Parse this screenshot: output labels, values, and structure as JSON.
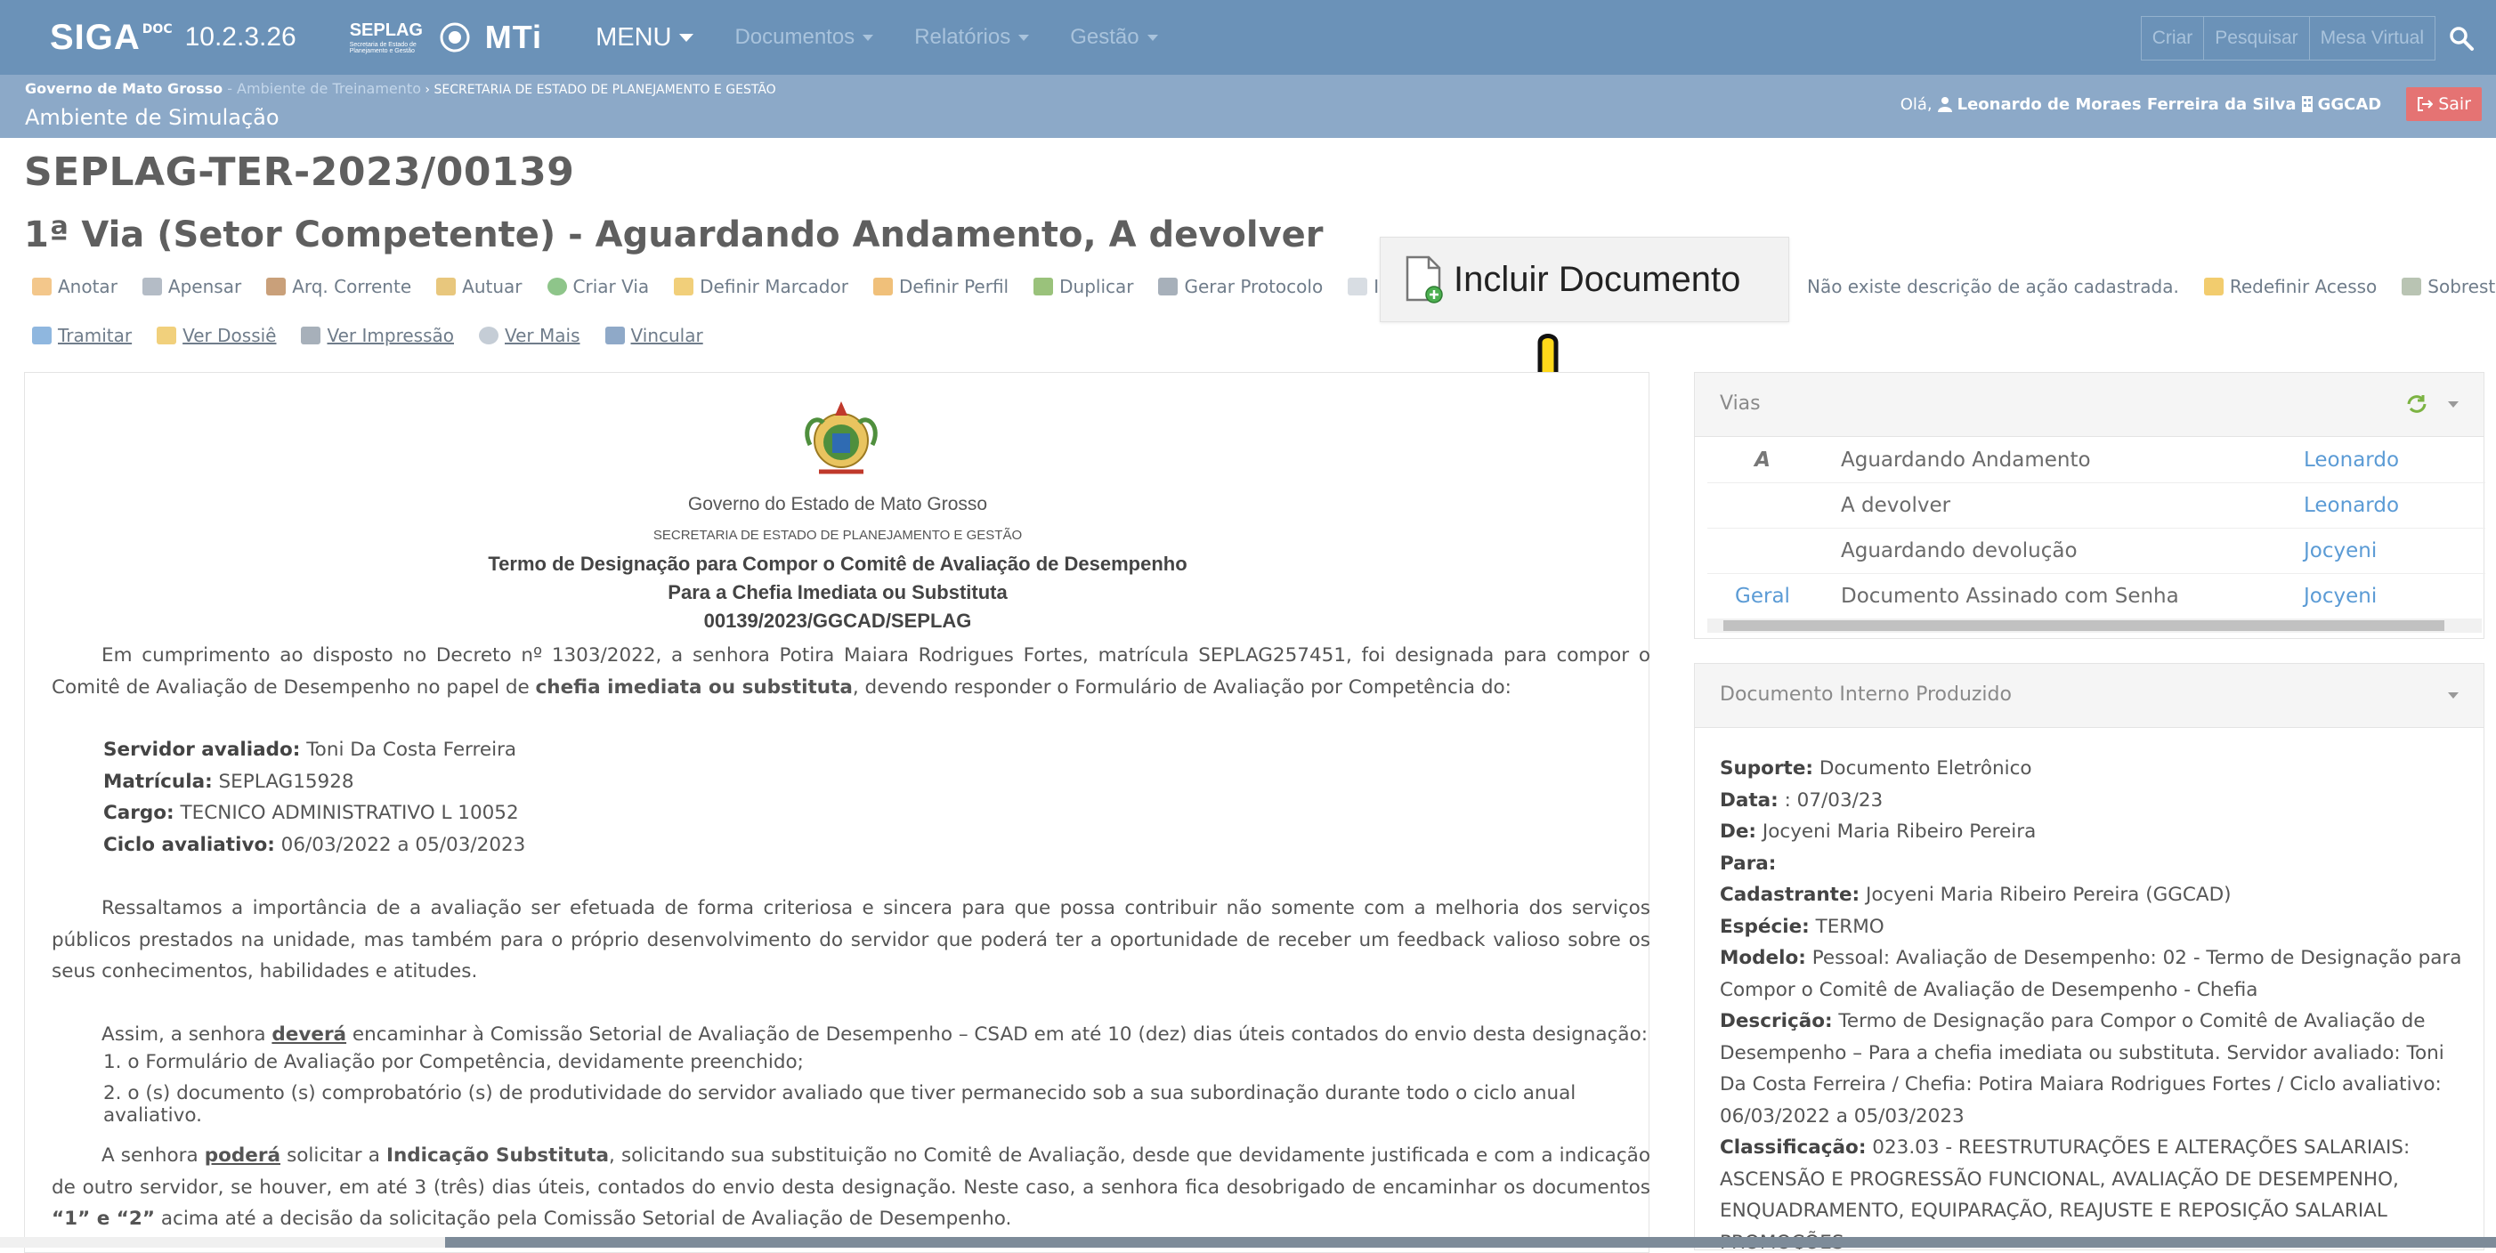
{
  "app": {
    "brand": "SIGA",
    "brand_sup": "DOC",
    "version": "10.2.3.26",
    "seplag": "SEPLAG",
    "seplag_sub": "Secretaria de Estado de Planejamento e Gestão",
    "mti": "MTi"
  },
  "nav": {
    "menu": "MENU",
    "items": [
      "Documentos",
      "Relatórios",
      "Gestão"
    ],
    "right_buttons": [
      "Criar",
      "Pesquisar",
      "Mesa Virtual"
    ]
  },
  "breadcrumb": {
    "gov": "Governo de Mato Grosso",
    "env": " - Ambiente de Treinamento",
    "sec": " › SECRETARIA DE ESTADO DE PLANEJAMENTO E GESTÃO",
    "sim": "Ambiente de Simulação"
  },
  "user": {
    "greeting": "Olá,",
    "name": "Leonardo de Moraes Ferreira da Silva",
    "unit": "GGCAD",
    "logout": "Sair"
  },
  "doc": {
    "code": "SEPLAG-TER-2023/00139",
    "status": "1ª Via (Setor Competente) - Aguardando Andamento, A devolver"
  },
  "toolbar": {
    "row1": [
      "Anotar",
      "Apensar",
      "Arq. Corrente",
      "Autuar",
      "Criar Via",
      "Definir Marcador",
      "Definir Perfil",
      "Duplicar",
      "Gerar Protocolo",
      "Inc",
      "Não existe descrição de ação cadastrada.",
      "Redefinir Acesso",
      "Sobrestar"
    ],
    "row2": [
      "Tramitar",
      "Ver Dossiê",
      "Ver Impressão",
      "Ver Mais",
      "Vincular"
    ]
  },
  "tooltip": {
    "label": "Incluir Documento"
  },
  "document": {
    "gov": "Governo do Estado de Mato Grosso",
    "sec": "SECRETARIA DE ESTADO DE PLANEJAMENTO E GESTÃO",
    "title": "Termo de Designação para Compor o Comitê de Avaliação de Desempenho",
    "subtitle": "Para a Chefia Imediata ou Substituta",
    "number": "00139/2023/GGCAD/SEPLAG",
    "p1_a": "Em cumprimento ao disposto no Decreto nº 1303/2022, a senhora Potira Maiara Rodrigues Fortes, matrícula SEPLAG257451, foi designada para compor o Comitê de Avaliação de Desempenho no papel de ",
    "p1_b": "chefia imediata ou substituta",
    "p1_c": ", devendo responder o Formulário de Avaliação por Competência do:",
    "fields": [
      {
        "label": "Servidor avaliado:",
        "value": "Toni Da Costa Ferreira"
      },
      {
        "label": "Matrícula:",
        "value": "SEPLAG15928"
      },
      {
        "label": "Cargo:",
        "value": "TECNICO ADMINISTRATIVO L 10052"
      },
      {
        "label": "Ciclo avaliativo:",
        "value": "06/03/2022 a 05/03/2023"
      }
    ],
    "p2": "Ressaltamos a importância de a avaliação ser efetuada de forma criteriosa e sincera para que possa contribuir não somente com a melhoria dos serviços públicos prestados na unidade, mas também para o próprio desenvolvimento do servidor que poderá ter a oportunidade de receber um feedback valioso sobre os seus conhecimentos, habilidades e atitudes.",
    "p3_a": "Assim, a senhora ",
    "p3_b": "deverá",
    "p3_c": " encaminhar à Comissão Setorial de Avaliação de Desempenho – CSAD em até 10 (dez) dias úteis contados do envio desta designação:",
    "item1": "1. o Formulário de Avaliação por Competência, devidamente preenchido;",
    "item2": "2. o (s) documento (s) comprobatório (s) de produtividade do servidor avaliado que tiver permanecido sob a sua subordinação durante todo o ciclo anual avaliativo.",
    "p4_a": "A senhora ",
    "p4_b": "poderá",
    "p4_c": " solicitar a ",
    "p4_d": "Indicação Substituta",
    "p4_e": ", solicitando sua substituição no Comitê de Avaliação, desde que devidamente justificada e com a indicação de outro servidor, se houver, em até 3 (três) dias úteis, contados do envio desta designação. Neste caso, a senhora fica desobrigado de encaminhar os documentos ",
    "p4_f": "“1” e “2”",
    "p4_g": " acima até a decisão da solicitação pela Comissão Setorial de Avaliação de Desempenho."
  },
  "vias": {
    "title": "Vias",
    "rows": [
      {
        "via": "A",
        "status": "Aguardando Andamento",
        "person": "Leonardo"
      },
      {
        "via": "",
        "status": "A devolver",
        "person": "Leonardo"
      },
      {
        "via": "",
        "status": "Aguardando devolução",
        "person": "Jocyeni"
      },
      {
        "via": "Geral",
        "status": "Documento Assinado com Senha",
        "person": "Jocyeni"
      }
    ]
  },
  "info": {
    "title": "Documento Interno Produzido",
    "suporte_l": "Suporte:",
    "suporte": "Documento Eletrônico",
    "data_l": "Data:",
    "data": ": 07/03/23",
    "de_l": "De:",
    "de": "Jocyeni Maria Ribeiro Pereira",
    "para_l": "Para:",
    "cad_l": "Cadastrante:",
    "cad": "Jocyeni Maria Ribeiro Pereira (GGCAD)",
    "esp_l": "Espécie:",
    "esp": "TERMO",
    "mod_l": "Modelo:",
    "mod": "Pessoal: Avaliação de Desempenho: 02 - Termo de Designação para Compor o Comitê de Avaliação de Desempenho - Chefia",
    "desc_l": "Descrição:",
    "desc": "Termo de Designação para Compor o Comitê de Avaliação de Desempenho – Para a chefia imediata ou substituta. Servidor avaliado: Toni Da Costa Ferreira / Chefia: Potira Maiara Rodrigues Fortes / Ciclo avaliativo: 06/03/2022 a 05/03/2023",
    "class_l": "Classificação:",
    "class": "023.03 - REESTRUTURAÇÕES E ALTERAÇÕES SALARIAIS: ASCENSÃO E PROGRESSÃO FUNCIONAL, AVALIAÇÃO DE DESEMPENHO, ENQUADRAMENTO, EQUIPARAÇÃO, REAJUSTE E REPOSIÇÃO SALARIAL PROMOÇÕES"
  },
  "colors": {
    "navbar": "#6b92b8",
    "subbar": "#8ca9c8",
    "link": "#5b9bd5",
    "logout": "#e57373"
  }
}
